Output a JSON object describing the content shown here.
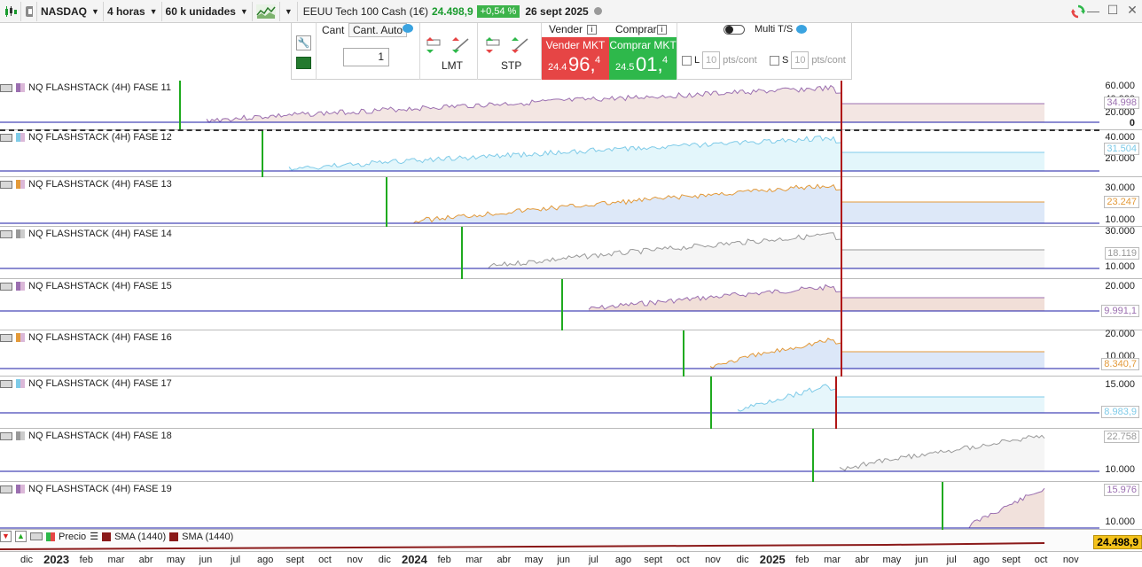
{
  "toolbar": {
    "market": "NASDAQ",
    "timeframe": "4 horas",
    "units": "60 k unidades",
    "instrument": "EEUU Tech 100 Cash (1€)",
    "last_price": "24.498,9",
    "change": "+0,54 %",
    "date": "26 sept 2025"
  },
  "order_bar": {
    "cant_label": "Cant",
    "cant_auto_label": "Cant. Auto",
    "quantity": "1",
    "lmt_label": "LMT",
    "stp_label": "STP",
    "sell_header": "Vender",
    "buy_header": "Comprar",
    "sell_mkt": "Vender MKT",
    "buy_mkt": "Comprar MKT",
    "sell_prefix": "24.4",
    "sell_big": "96,",
    "sell_sup": "4",
    "buy_prefix": "24.5",
    "buy_big": "01,",
    "buy_sup": "4",
    "multi_ts": "Multi T/S",
    "l_label": "L",
    "s_label": "S",
    "pts_value": "10",
    "pts_unit": "pts/cont"
  },
  "panels": [
    {
      "name": "NQ FLASHSTACK (4H) FASE 11",
      "ticks": [
        "60.000",
        "40.000",
        "20.000",
        "0"
      ],
      "last": "34.998",
      "color": "#9b6fb0",
      "fill": "#f3e6e3",
      "start": 0.07
    },
    {
      "name": "NQ FLASHSTACK (4H) FASE 12",
      "ticks": [
        "40.000",
        "20.000"
      ],
      "last": "31.504",
      "color": "#7fcbe8",
      "fill": "#e3f6fb",
      "start": 0.18
    },
    {
      "name": "NQ FLASHSTACK (4H) FASE 13",
      "ticks": [
        "30.000",
        "10.000"
      ],
      "last": "23.247",
      "color": "#e39a3a",
      "fill": "#dde8f8",
      "start": 0.35
    },
    {
      "name": "NQ FLASHSTACK (4H) FASE 14",
      "ticks": [
        "30.000",
        "10.000"
      ],
      "last": "18.119",
      "color": "#999999",
      "fill": "#f5f5f5",
      "start": 0.45
    },
    {
      "name": "NQ FLASHSTACK (4H) FASE 15",
      "ticks": [
        "20.000"
      ],
      "last": "9.991,1",
      "color": "#9b6fb0",
      "fill": "#f1dfd8",
      "start": 0.6
    },
    {
      "name": "NQ FLASHSTACK (4H) FASE 16",
      "ticks": [
        "20.000",
        "10.000"
      ],
      "last": "8.340,7",
      "color": "#e39a3a",
      "fill": "#dce7f8",
      "start": 0.77
    },
    {
      "name": "NQ FLASHSTACK (4H) FASE 17",
      "ticks": [
        "15.000"
      ],
      "last": "8.983,9",
      "color": "#7fcbe8",
      "fill": "#e6f6fb",
      "start": 0.81
    },
    {
      "name": "NQ FLASHSTACK (4H) FASE 18",
      "ticks": [
        "10.000"
      ],
      "last": "22.758",
      "color": "#999999",
      "fill": "#f5f5f5",
      "start": 0.0
    },
    {
      "name": "NQ FLASHSTACK (4H) FASE 19",
      "ticks": [
        "10.000"
      ],
      "last": "15.976",
      "color": "#9b6fb0",
      "fill": "#f1e1dc",
      "start": 0.0
    }
  ],
  "bottom": {
    "precio": "Precio",
    "sma1": "SMA (1440)",
    "sma2": "SMA (1440)",
    "price_badge": "24.498,9"
  },
  "time_axis": [
    {
      "t": "dic",
      "year": false
    },
    {
      "t": "2023",
      "year": true
    },
    {
      "t": "feb",
      "year": false
    },
    {
      "t": "mar",
      "year": false
    },
    {
      "t": "abr",
      "year": false
    },
    {
      "t": "may",
      "year": false
    },
    {
      "t": "jun",
      "year": false
    },
    {
      "t": "jul",
      "year": false
    },
    {
      "t": "ago",
      "year": false
    },
    {
      "t": "sept",
      "year": false
    },
    {
      "t": "oct",
      "year": false
    },
    {
      "t": "nov",
      "year": false
    },
    {
      "t": "dic",
      "year": false
    },
    {
      "t": "2024",
      "year": true
    },
    {
      "t": "feb",
      "year": false
    },
    {
      "t": "mar",
      "year": false
    },
    {
      "t": "abr",
      "year": false
    },
    {
      "t": "may",
      "year": false
    },
    {
      "t": "jun",
      "year": false
    },
    {
      "t": "jul",
      "year": false
    },
    {
      "t": "ago",
      "year": false
    },
    {
      "t": "sept",
      "year": false
    },
    {
      "t": "oct",
      "year": false
    },
    {
      "t": "nov",
      "year": false
    },
    {
      "t": "dic",
      "year": false
    },
    {
      "t": "2025",
      "year": true
    },
    {
      "t": "feb",
      "year": false
    },
    {
      "t": "mar",
      "year": false
    },
    {
      "t": "abr",
      "year": false
    },
    {
      "t": "may",
      "year": false
    },
    {
      "t": "jun",
      "year": false
    },
    {
      "t": "jul",
      "year": false
    },
    {
      "t": "ago",
      "year": false
    },
    {
      "t": "sept",
      "year": false
    },
    {
      "t": "oct",
      "year": false
    },
    {
      "t": "nov",
      "year": false
    }
  ],
  "colors": {
    "sell": "#e64545",
    "buy": "#2eb84b",
    "entry_line": "#1faa1f",
    "exit_line": "#b01515",
    "base_line": "#1a1aa6"
  }
}
